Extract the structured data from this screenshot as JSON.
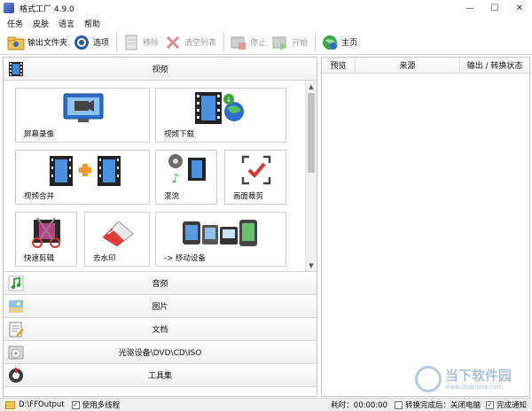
{
  "window": {
    "title": "格式工厂 4.9.0",
    "controls": [
      "—",
      "☐",
      "✕"
    ]
  },
  "menu": [
    "任务",
    "皮肤",
    "语言",
    "帮助"
  ],
  "toolbar": {
    "output_folder": "输出文件夹",
    "options": "选项",
    "remove": "移除",
    "clear_list": "清空列表",
    "stop": "停止",
    "start": "开始",
    "home": "主页"
  },
  "categories": {
    "video": "视频",
    "audio": "音频",
    "image": "图片",
    "document": "文档",
    "optical": "光驱设备\\DVD\\CD\\ISO",
    "tools": "工具集"
  },
  "tiles": {
    "screen_record": "屏幕录像",
    "video_download": "视频下载",
    "video_merge": "视频合并",
    "mix_stream": "混流",
    "crop": "画面裁剪",
    "quick_edit": "快速剪辑",
    "remove_watermark": "去水印",
    "to_mobile": "-> 移动设备"
  },
  "task_table": {
    "columns": [
      "预览",
      "来源",
      "输出 / 转换状态"
    ]
  },
  "status": {
    "output_path": "D:\\FFOutput",
    "multithread": "使用多线程",
    "elapsed": "耗时：00:00:00",
    "after_convert": "转换完成后：关闭电脑",
    "notify": "完成通知",
    "multithread_checked": true,
    "after_convert_checked": false,
    "notify_checked": true
  },
  "watermark": {
    "brand": "当下软件园",
    "url": "www.downxia.com"
  }
}
